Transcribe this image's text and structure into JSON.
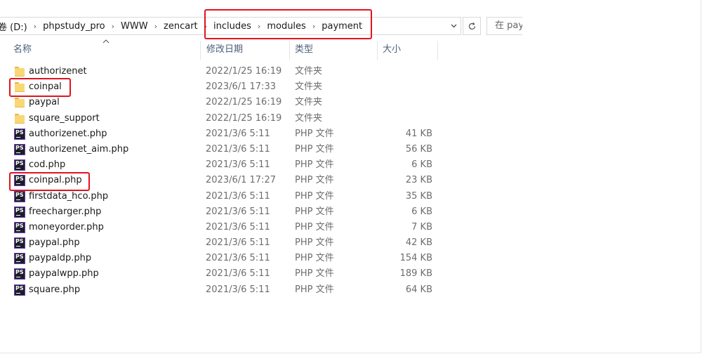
{
  "breadcrumb": [
    {
      "label": "卷 (D:)"
    },
    {
      "label": "phpstudy_pro"
    },
    {
      "label": "WWW"
    },
    {
      "label": "zencart"
    },
    {
      "label": "includes"
    },
    {
      "label": "modules"
    },
    {
      "label": "payment"
    }
  ],
  "search": {
    "placeholder": "在 pay"
  },
  "columns": {
    "name": "名称",
    "date": "修改日期",
    "type": "类型",
    "size": "大小"
  },
  "files": [
    {
      "name": "authorizenet",
      "date": "2022/1/25 16:19",
      "type": "文件夹",
      "size": "",
      "icon": "folder-icon"
    },
    {
      "name": "coinpal",
      "date": "2023/6/1 17:33",
      "type": "文件夹",
      "size": "",
      "icon": "folder-icon"
    },
    {
      "name": "paypal",
      "date": "2022/1/25 16:19",
      "type": "文件夹",
      "size": "",
      "icon": "folder-icon"
    },
    {
      "name": "square_support",
      "date": "2022/1/25 16:19",
      "type": "文件夹",
      "size": "",
      "icon": "folder-icon"
    },
    {
      "name": "authorizenet.php",
      "date": "2021/3/6 5:11",
      "type": "PHP 文件",
      "size": "41 KB",
      "icon": "php-file-icon"
    },
    {
      "name": "authorizenet_aim.php",
      "date": "2021/3/6 5:11",
      "type": "PHP 文件",
      "size": "56 KB",
      "icon": "php-file-icon"
    },
    {
      "name": "cod.php",
      "date": "2021/3/6 5:11",
      "type": "PHP 文件",
      "size": "6 KB",
      "icon": "php-file-icon"
    },
    {
      "name": "coinpal.php",
      "date": "2023/6/1 17:27",
      "type": "PHP 文件",
      "size": "23 KB",
      "icon": "php-file-icon"
    },
    {
      "name": "firstdata_hco.php",
      "date": "2021/3/6 5:11",
      "type": "PHP 文件",
      "size": "35 KB",
      "icon": "php-file-icon"
    },
    {
      "name": "freecharger.php",
      "date": "2021/3/6 5:11",
      "type": "PHP 文件",
      "size": "6 KB",
      "icon": "php-file-icon"
    },
    {
      "name": "moneyorder.php",
      "date": "2021/3/6 5:11",
      "type": "PHP 文件",
      "size": "7 KB",
      "icon": "php-file-icon"
    },
    {
      "name": "paypal.php",
      "date": "2021/3/6 5:11",
      "type": "PHP 文件",
      "size": "42 KB",
      "icon": "php-file-icon"
    },
    {
      "name": "paypaldp.php",
      "date": "2021/3/6 5:11",
      "type": "PHP 文件",
      "size": "154 KB",
      "icon": "php-file-icon"
    },
    {
      "name": "paypalwpp.php",
      "date": "2021/3/6 5:11",
      "type": "PHP 文件",
      "size": "189 KB",
      "icon": "php-file-icon"
    },
    {
      "name": "square.php",
      "date": "2021/3/6 5:11",
      "type": "PHP 文件",
      "size": "64 KB",
      "icon": "php-file-icon"
    }
  ],
  "php_icon_text": "PS",
  "colors": {
    "highlight": "#e0141e",
    "header_text": "#4c607a",
    "folder": "#f8d775"
  }
}
